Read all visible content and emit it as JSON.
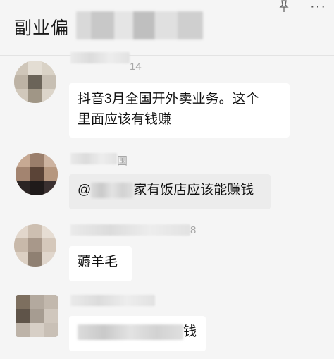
{
  "header": {
    "title": "副业偏",
    "more_label": "···",
    "pin_icon": "pin-icon"
  },
  "messages": [
    {
      "meta": "14",
      "text_line1": "抖音3月全国开外卖业务。这个",
      "text_line2": "里面应该有钱赚"
    },
    {
      "meta": "国",
      "prefix": "@",
      "suffix": "家有饭店应该能赚钱"
    },
    {
      "meta": "8",
      "text": "薅羊毛"
    },
    {
      "suffix": "钱"
    }
  ],
  "colors": {
    "background": "#f5f5f5",
    "bubble": "#ffffff",
    "quote_bubble": "#ececec",
    "meta": "#a8a8a8"
  }
}
